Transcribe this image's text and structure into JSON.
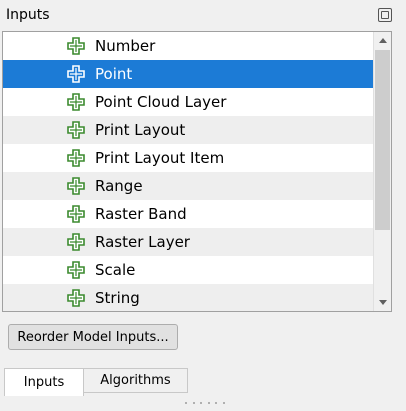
{
  "panel": {
    "title": "Inputs",
    "float_icon": "float-panel-icon"
  },
  "inputs_list": {
    "icon": "plus-icon",
    "icon_color": "#3b8a2e",
    "selected_color": "#1c7bd6",
    "items": [
      {
        "label": "Number",
        "selected": false
      },
      {
        "label": "Point",
        "selected": true
      },
      {
        "label": "Point Cloud Layer",
        "selected": false
      },
      {
        "label": "Print Layout",
        "selected": false
      },
      {
        "label": "Print Layout Item",
        "selected": false
      },
      {
        "label": "Range",
        "selected": false
      },
      {
        "label": "Raster Band",
        "selected": false
      },
      {
        "label": "Raster Layer",
        "selected": false
      },
      {
        "label": "Scale",
        "selected": false
      },
      {
        "label": "String",
        "selected": false
      }
    ]
  },
  "buttons": {
    "reorder": "Reorder Model Inputs..."
  },
  "tabs": [
    {
      "label": "Inputs",
      "active": true
    },
    {
      "label": "Algorithms",
      "active": false
    }
  ]
}
